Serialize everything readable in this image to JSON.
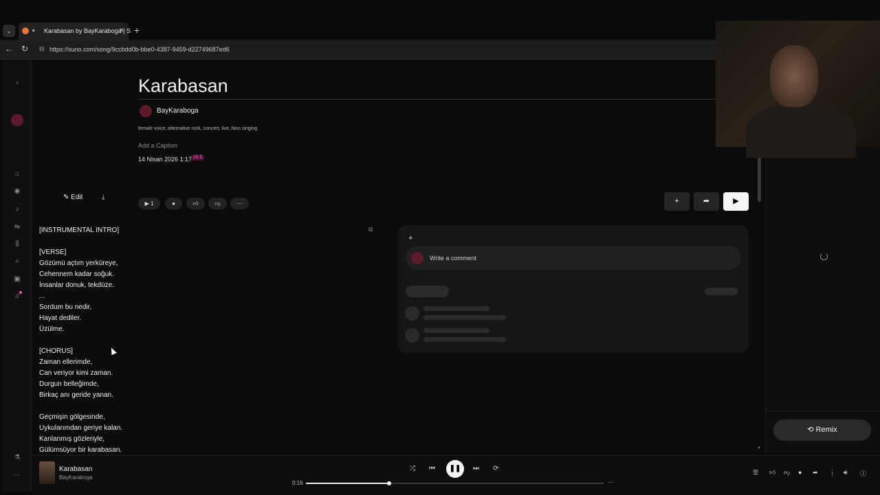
{
  "browser": {
    "tab_title": "Karabasan by BayKaraboga | S",
    "url": "https://suno.com/song/9ccbdd0b-bbe0-4387-9459-d22749687ed6",
    "new_tab": "+",
    "tab_close": "✕"
  },
  "song": {
    "title": "Karabasan",
    "artist": "BayKaraboga",
    "tags": "female voice, alternative rock, concert, live, fans singing",
    "caption_placeholder": "Add a Caption",
    "date": "14 Nisan 2026 1:17",
    "version": "v5.5",
    "edit_label": "Edit",
    "play_count": "1"
  },
  "lyrics": [
    "[INSTRUMENTAL INTRO]",
    "",
    "[VERSE]",
    "Gözümü açtım yerküreye,",
    "Cehennem kadar soğuk.",
    "İnsanlar donuk, tekdüze.",
    "...",
    "Sordum bu nedir,",
    "Hayat dediler.",
    "Üzülme.",
    "",
    "[CHORUS]",
    "Zaman ellerimde,",
    "Can veriyor kimi zaman.",
    "Durgun belleğimde,",
    "Birkaç anı geride yanan.",
    "",
    "Geçmişin gölgesinde,",
    "Uykularımdan geriye kalan.",
    "Kanlanmış gözleriyle,",
    "Gülümsüyor bir karabasan."
  ],
  "comments": {
    "placeholder": "Write a comment"
  },
  "remix_label": "Remix",
  "player": {
    "title": "Karabasan",
    "artist": "BayKaraboga",
    "elapsed": "0:16",
    "progress": 0.28
  },
  "colors": {
    "background": "#0b0b0d",
    "version_badge": "#ff5fc3",
    "card": "#161618"
  }
}
